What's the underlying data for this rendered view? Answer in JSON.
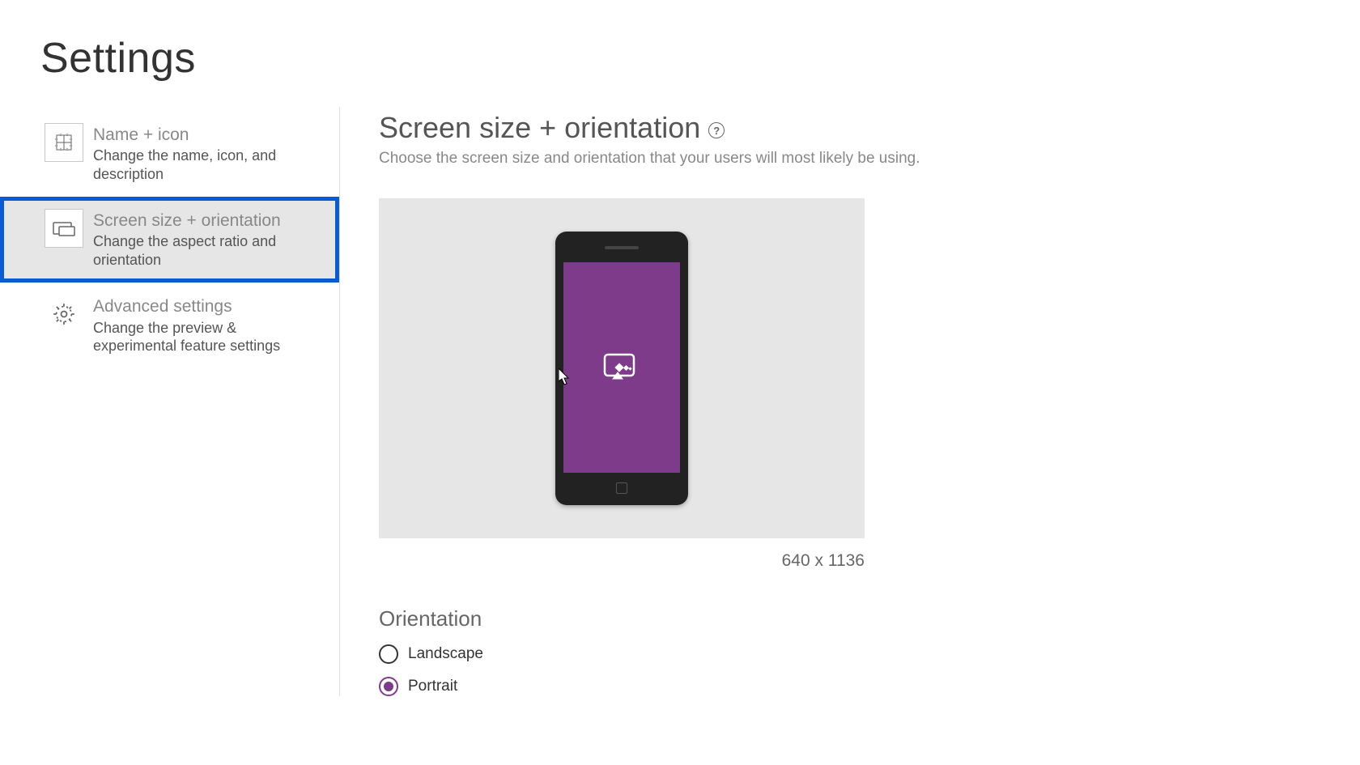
{
  "page_title": "Settings",
  "sidebar": {
    "items": [
      {
        "label": "Name + icon",
        "desc": "Change the name, icon, and description"
      },
      {
        "label": "Screen size + orientation",
        "desc": "Change the aspect ratio and orientation"
      },
      {
        "label": "Advanced settings",
        "desc": "Change the preview & experimental feature settings"
      }
    ]
  },
  "main": {
    "title": "Screen size + orientation",
    "help": "?",
    "desc": "Choose the screen size and orientation that your users will most likely be using.",
    "dimensions": "640 x 1136",
    "orientation_label": "Orientation",
    "options": {
      "landscape": "Landscape",
      "portrait": "Portrait"
    },
    "selected_orientation": "portrait"
  }
}
